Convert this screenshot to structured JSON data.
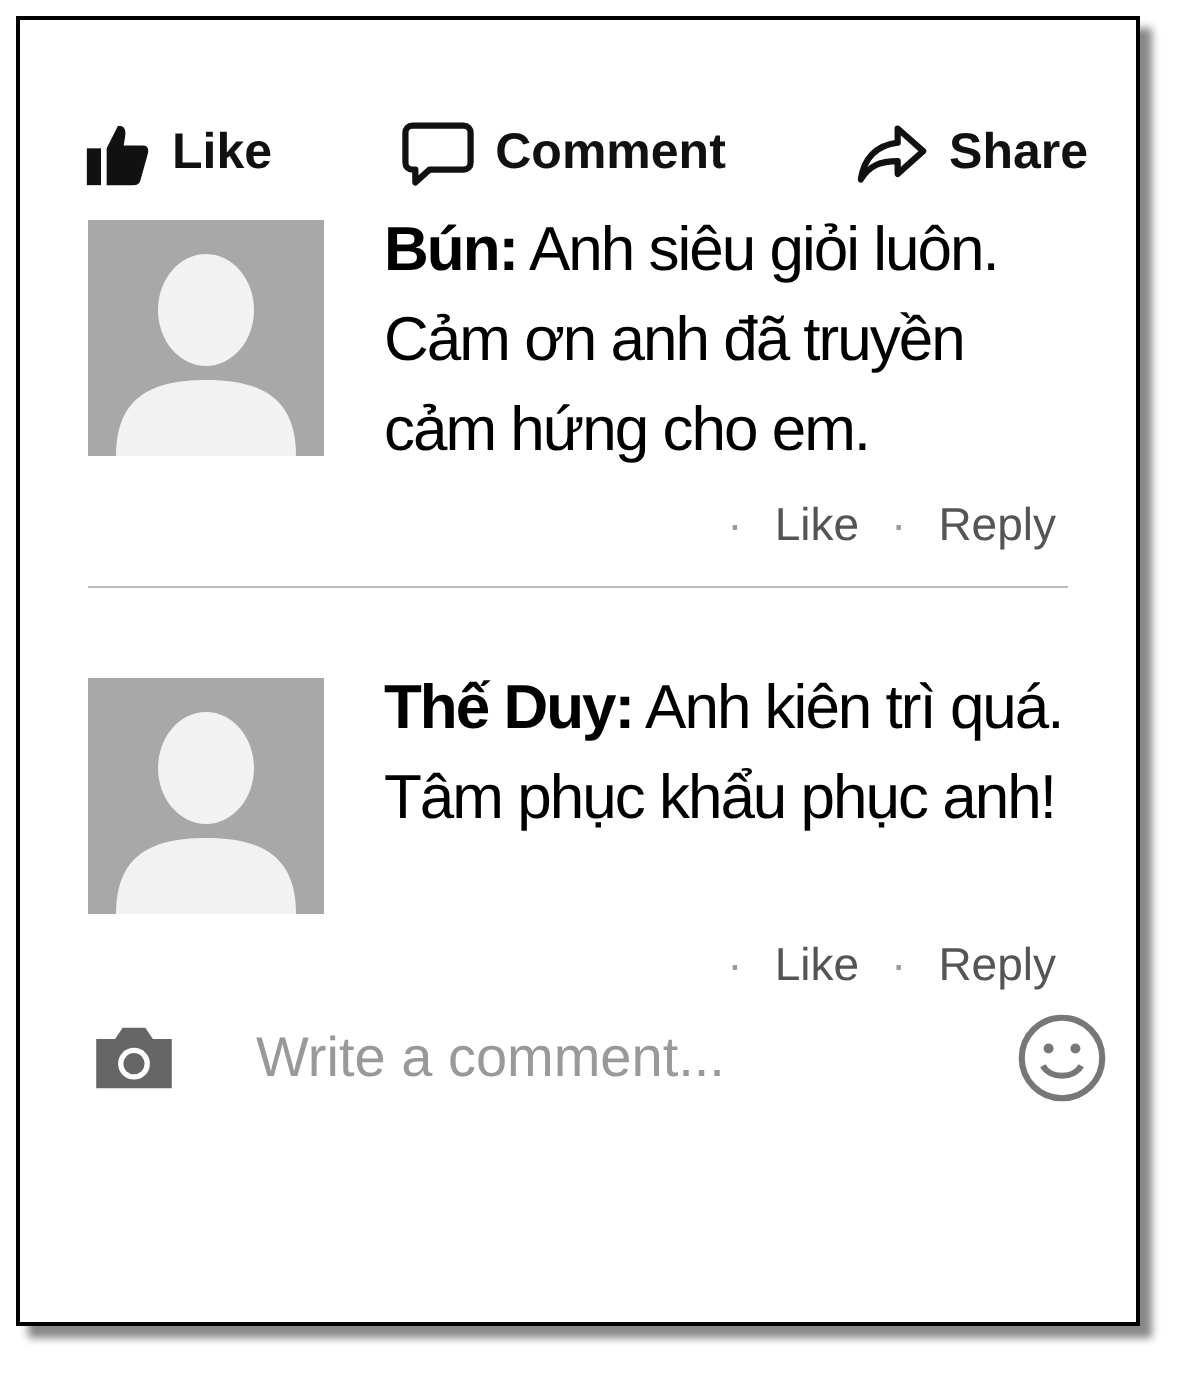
{
  "actions": [
    {
      "kind": "like",
      "label": "Like"
    },
    {
      "kind": "comment",
      "label": "Comment"
    },
    {
      "kind": "share",
      "label": "Share"
    }
  ],
  "comments": [
    {
      "author": "Bún:",
      "text": "Anh siêu giỏi luôn. Cảm ơn anh đã truyền cảm hứng cho em.",
      "links": [
        {
          "dot": "·",
          "label": "Like"
        },
        {
          "dot": "·",
          "label": "Reply"
        }
      ]
    },
    {
      "author": "Thế Duy:",
      "text": "Anh kiên trì quá. Tâm phục khẩu phục anh!",
      "links": [
        {
          "dot": "·",
          "label": "Like"
        },
        {
          "dot": "·",
          "label": "Reply"
        }
      ]
    }
  ],
  "composer": {
    "placeholder": "Write a comment..."
  }
}
